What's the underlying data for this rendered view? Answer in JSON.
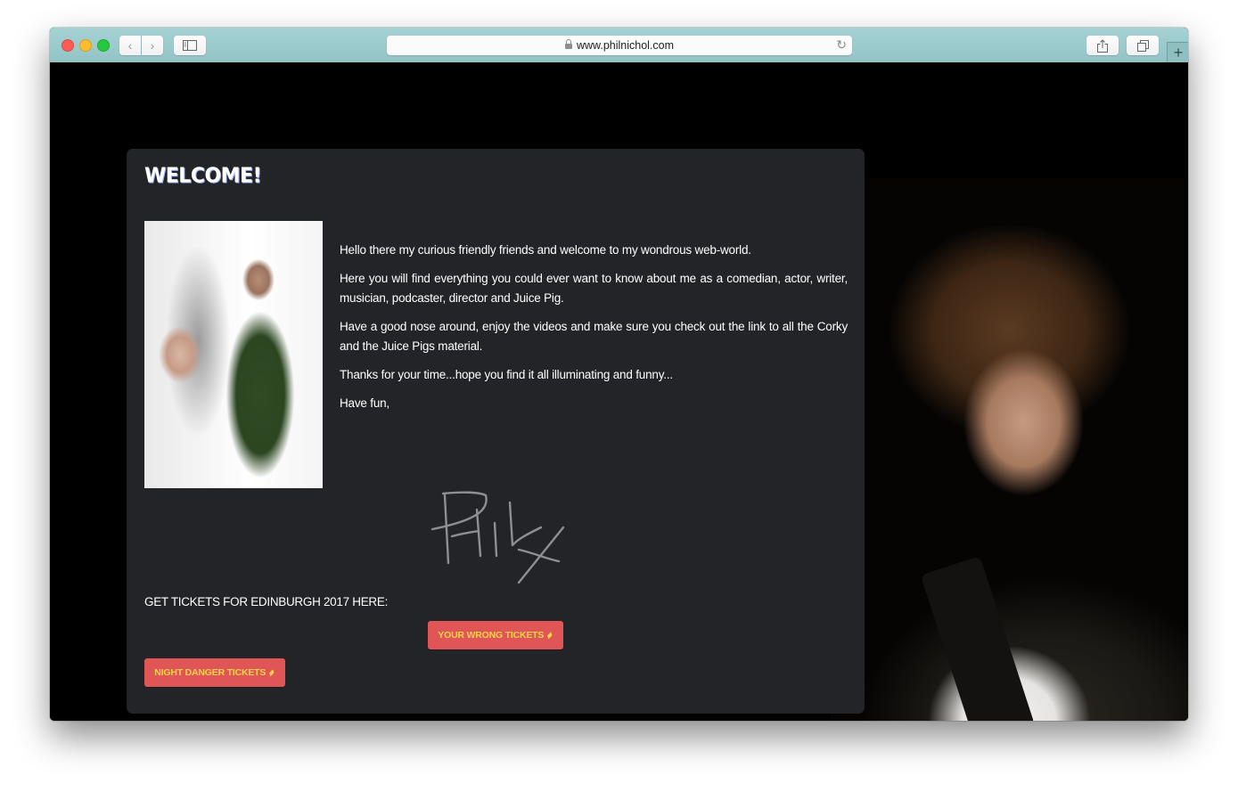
{
  "browser": {
    "url": "www.philnichol.com",
    "back_icon": "‹",
    "forward_icon": "›",
    "reload_icon": "↻",
    "new_tab_icon": "+"
  },
  "welcome": {
    "title": "WELCOME!",
    "paragraphs": [
      "Hello there my curious friendly friends and welcome to my wondrous web-world.",
      "Here you will find everything you could ever want to know about me as a comedian, actor, writer, musician, podcaster, director and Juice Pig.",
      "Have a good nose around, enjoy the videos and make sure you check out the link to all the Corky and the Juice Pigs material.",
      "Thanks for your time...hope you find it all illuminating and funny...",
      "Have fun,"
    ],
    "signature": "PHIL x"
  },
  "tickets": {
    "heading": "GET TICKETS FOR EDINBURGH 2017 HERE:",
    "buttons": [
      {
        "label": "YOUR WRONG TICKETS",
        "icon": "ticket-icon"
      },
      {
        "label": "NIGHT DANGER TICKETS",
        "icon": "ticket-icon"
      }
    ],
    "button_color": "#e05555",
    "button_text_color": "#f7d34a"
  }
}
